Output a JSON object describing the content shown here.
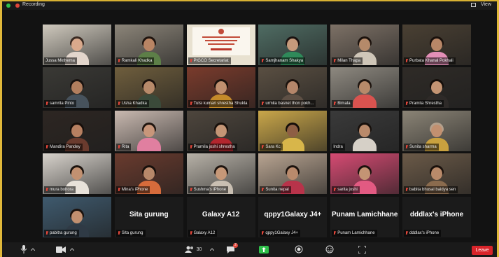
{
  "topbar": {
    "recording_label": "Recording",
    "view_label": "View"
  },
  "tiles": [
    {
      "name": "Jussa Mkthema",
      "muted": false,
      "type": "video",
      "bg": "#cfc9bd",
      "shirt": "#e3d6cc",
      "skin": "#d9a98c",
      "hair": "#3a2a22",
      "active": true
    },
    {
      "name": "Ramkali Khadka",
      "muted": true,
      "type": "video",
      "bg": "#8c8579",
      "shirt": "#5d7f48",
      "skin": "#b98564",
      "hair": "#1f140e"
    },
    {
      "name": "PIGCO Secretariat",
      "muted": true,
      "type": "doc",
      "bg": "#e8e1d0"
    },
    {
      "name": "Samjhanam Shakya",
      "muted": true,
      "type": "video",
      "bg": "#4f6c63",
      "shirt": "#2f8a5a",
      "skin": "#c59a7b",
      "hair": "#1a1210"
    },
    {
      "name": "Milan Thapa",
      "muted": true,
      "type": "video",
      "bg": "#7d7166",
      "shirt": "#cfc6b8",
      "skin": "#b58a6a",
      "hair": "#1b120d"
    },
    {
      "name": "Purbata Khanal Pokhali",
      "muted": true,
      "type": "video",
      "bg": "#4a4033",
      "shirt": "#e38fb7",
      "skin": "#b88767",
      "hair": "#1a110c"
    },
    {
      "name": "samrita Pinto",
      "muted": true,
      "type": "video",
      "bg": "#3a3935",
      "shirt": "#47525c",
      "skin": "#b17e5e",
      "hair": "#181210"
    },
    {
      "name": "Usha Khadka",
      "muted": true,
      "type": "video",
      "bg": "#6f5e3d",
      "shirt": "#3b4a3a",
      "skin": "#b78a6a",
      "hair": "#1b120d"
    },
    {
      "name": "Tulsi kumari shrestha Shukla",
      "muted": true,
      "type": "video",
      "bg": "#7a3b2c",
      "shirt": "#c48a2a",
      "skin": "#c0906f",
      "hair": "#1a110c"
    },
    {
      "name": "urmila basnet thon pokh...",
      "muted": true,
      "type": "video",
      "bg": "#5a4f42",
      "shirt": "#5e5045",
      "skin": "#b5866a",
      "hair": "#1b120d"
    },
    {
      "name": "Bimala",
      "muted": true,
      "type": "video",
      "bg": "#8e8980",
      "shirt": "#d9534f",
      "skin": "#b78a6a",
      "hair": "#1c130e"
    },
    {
      "name": "Pramila Shrestha",
      "muted": true,
      "type": "video",
      "bg": "#2f2b27",
      "shirt": "#2e2a28",
      "skin": "#c49473",
      "hair": "#140d09"
    },
    {
      "name": "Mandira Pandey",
      "muted": true,
      "type": "video",
      "bg": "#2d2622",
      "shirt": "#6a3b2e",
      "skin": "#b78061",
      "hair": "#160e0a"
    },
    {
      "name": "Rita",
      "muted": true,
      "type": "video",
      "bg": "#c9b9b0",
      "shirt": "#e07fa0",
      "skin": "#c8967a",
      "hair": "#1f150f"
    },
    {
      "name": "Pramila joshi shrestha",
      "muted": true,
      "type": "video",
      "bg": "#4e463d",
      "shirt": "#b3262e",
      "skin": "#c49676",
      "hair": "#170f0a"
    },
    {
      "name": "Sara Kc",
      "muted": true,
      "type": "video",
      "bg": "#caa74a",
      "shirt": "#d8b64a",
      "skin": "#8e5f44",
      "hair": "#140d09"
    },
    {
      "name": "Indra",
      "muted": false,
      "type": "video",
      "bg": "#3a3a3a",
      "shirt": "#d6d0c7",
      "skin": "#b98a6b",
      "hair": "#160f0b"
    },
    {
      "name": "Sunita sharma",
      "muted": true,
      "type": "video",
      "bg": "#8b8476",
      "shirt": "#c9a13f",
      "skin": "#c29070",
      "hair": "#b4a08c"
    },
    {
      "name": "mura bohora",
      "muted": true,
      "type": "video",
      "bg": "#d8d3cc",
      "shirt": "#e8e2da",
      "skin": "#c29171",
      "hair": "#1b130e"
    },
    {
      "name": "Mina's iPhone",
      "muted": true,
      "type": "video",
      "bg": "#6a3b2e",
      "shirt": "#d66b3b",
      "skin": "#b8886a",
      "hair": "#170f0b"
    },
    {
      "name": "Sushma's iPhone",
      "muted": true,
      "type": "video",
      "bg": "#b8b2a8",
      "shirt": "#c9bfb2",
      "skin": "#c69878",
      "hair": "#1d140f"
    },
    {
      "name": "Sunita nepal",
      "muted": true,
      "type": "video",
      "bg": "#b9a592",
      "shirt": "#b8334a",
      "skin": "#b98a6c",
      "hair": "#1b120d"
    },
    {
      "name": "sarita joshi",
      "muted": true,
      "type": "video",
      "bg": "#d64b73",
      "shirt": "#e25a82",
      "skin": "#c49474",
      "hair": "#1b120d"
    },
    {
      "name": "babita bhusal baidya sen",
      "muted": true,
      "type": "video",
      "bg": "#6b5a48",
      "shirt": "#8a6b4e",
      "skin": "#b98a6a",
      "hair": "#1a110c"
    },
    {
      "name": "pabitra gurung",
      "muted": true,
      "type": "video",
      "bg": "#3f5a6e",
      "shirt": "#2f3a45",
      "skin": "#c29070",
      "hair": "#1b120d"
    },
    {
      "name": "Sita gurung",
      "muted": true,
      "type": "text",
      "big": "Sita gurung"
    },
    {
      "name": "Galaxy A12",
      "muted": true,
      "type": "text",
      "big": "Galaxy A12"
    },
    {
      "name": "qppy1Galaxy J4+",
      "muted": true,
      "type": "text",
      "big": "qppy1Galaxy J4+"
    },
    {
      "name": "Punam Lamichhane",
      "muted": true,
      "type": "text",
      "big": "Punam Lamichhane"
    },
    {
      "name": "dddlax's iPhone",
      "muted": true,
      "type": "text",
      "big": "dddlax's iPhone"
    }
  ],
  "toolbar": {
    "participants_count": "30",
    "chat_badge": "2",
    "leave_label": "Leave"
  },
  "colors": {
    "leave": "#d8242a",
    "active_border": "#f3e65a",
    "mute": "#e0463a"
  }
}
